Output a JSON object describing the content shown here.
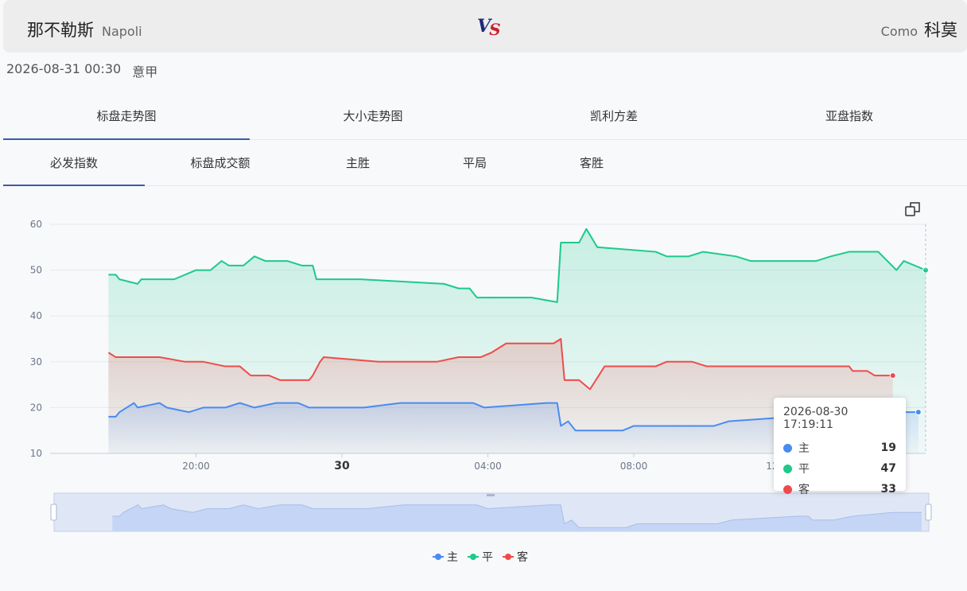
{
  "header": {
    "home_cn": "那不勒斯",
    "home_en": "Napoli",
    "away_en": "Como",
    "away_cn": "科莫",
    "vs_v": "V",
    "vs_s": "S"
  },
  "match_info": {
    "datetime": "2026-08-31 00:30",
    "league": "意甲"
  },
  "tabs": [
    {
      "label": "标盘走势图",
      "active": true
    },
    {
      "label": "大小走势图",
      "active": false
    },
    {
      "label": "凯利方差",
      "active": false
    },
    {
      "label": "亚盘指数",
      "active": false
    }
  ],
  "subtabs": [
    {
      "label": "必发指数",
      "active": true
    },
    {
      "label": "标盘成交额",
      "active": false
    },
    {
      "label": "主胜",
      "active": false
    },
    {
      "label": "平局",
      "active": false
    },
    {
      "label": "客胜",
      "active": false
    }
  ],
  "tooltip": {
    "time": "2026-08-30 17:19:11",
    "rows": [
      {
        "name": "主",
        "value": "19"
      },
      {
        "name": "平",
        "value": "47"
      },
      {
        "name": "客",
        "value": "33"
      }
    ]
  },
  "legend": [
    "主",
    "平",
    "客"
  ],
  "colors": {
    "home": "#4a8bf0",
    "draw": "#1ec98a",
    "away": "#ef4b4b",
    "accent": "#3d5aa9"
  },
  "chart_data": {
    "type": "area",
    "x_unit": "hours",
    "x_range": [
      17.0,
      29.0
    ],
    "x_ticks": [
      {
        "x": 19.0,
        "label": "20:00",
        "bold": false
      },
      {
        "x": 21.0,
        "label": "30",
        "bold": true
      },
      {
        "x": 23.0,
        "label": "04:00",
        "bold": false
      },
      {
        "x": 25.0,
        "label": "08:00",
        "bold": false
      },
      {
        "x": 27.0,
        "label": "12:00",
        "bold": false
      }
    ],
    "y_range": [
      10,
      60
    ],
    "y_ticks": [
      10,
      20,
      30,
      40,
      50,
      60
    ],
    "series": [
      {
        "name": "主",
        "color": "#4a8bf0",
        "points": [
          [
            17.8,
            18
          ],
          [
            17.9,
            18
          ],
          [
            17.95,
            19
          ],
          [
            18.15,
            21
          ],
          [
            18.2,
            20
          ],
          [
            18.5,
            21
          ],
          [
            18.6,
            20
          ],
          [
            18.9,
            19
          ],
          [
            19.1,
            20
          ],
          [
            19.4,
            20
          ],
          [
            19.6,
            21
          ],
          [
            19.8,
            20
          ],
          [
            19.95,
            20.5
          ],
          [
            20.1,
            21
          ],
          [
            20.4,
            21
          ],
          [
            20.55,
            20
          ],
          [
            21.3,
            20
          ],
          [
            21.8,
            21
          ],
          [
            22.8,
            21
          ],
          [
            22.95,
            20
          ],
          [
            23.8,
            21
          ],
          [
            23.95,
            21
          ],
          [
            24.0,
            16
          ],
          [
            24.1,
            17
          ],
          [
            24.2,
            15
          ],
          [
            24.85,
            15
          ],
          [
            25.0,
            16
          ],
          [
            25.2,
            16
          ],
          [
            25.6,
            16
          ],
          [
            26.1,
            16
          ],
          [
            26.3,
            17
          ],
          [
            27.2,
            18
          ],
          [
            27.35,
            18
          ],
          [
            27.4,
            17
          ],
          [
            27.7,
            17
          ],
          [
            27.95,
            18
          ],
          [
            28.5,
            19
          ],
          [
            28.9,
            19
          ]
        ]
      },
      {
        "name": "平",
        "color": "#1ec98a",
        "points": [
          [
            17.8,
            49
          ],
          [
            17.9,
            49
          ],
          [
            17.95,
            48
          ],
          [
            18.2,
            47
          ],
          [
            18.25,
            48
          ],
          [
            18.7,
            48
          ],
          [
            19.0,
            50
          ],
          [
            19.2,
            50
          ],
          [
            19.35,
            52
          ],
          [
            19.45,
            51
          ],
          [
            19.65,
            51
          ],
          [
            19.8,
            53
          ],
          [
            19.95,
            52
          ],
          [
            20.25,
            52
          ],
          [
            20.45,
            51
          ],
          [
            20.6,
            51
          ],
          [
            20.65,
            48
          ],
          [
            21.25,
            48
          ],
          [
            22.4,
            47
          ],
          [
            22.6,
            46
          ],
          [
            22.75,
            46
          ],
          [
            22.85,
            44
          ],
          [
            23.6,
            44
          ],
          [
            23.95,
            43
          ],
          [
            24.0,
            56
          ],
          [
            24.25,
            56
          ],
          [
            24.35,
            59
          ],
          [
            24.5,
            55
          ],
          [
            25.3,
            54
          ],
          [
            25.45,
            53
          ],
          [
            25.75,
            53
          ],
          [
            25.95,
            54
          ],
          [
            26.4,
            53
          ],
          [
            26.6,
            52
          ],
          [
            26.9,
            52
          ],
          [
            27.5,
            52
          ],
          [
            27.7,
            53
          ],
          [
            27.95,
            54
          ],
          [
            28.35,
            54
          ],
          [
            28.6,
            50
          ],
          [
            28.7,
            52
          ],
          [
            29.0,
            50
          ]
        ]
      },
      {
        "name": "客",
        "color": "#ef4b4b",
        "points": [
          [
            17.8,
            32
          ],
          [
            17.9,
            31
          ],
          [
            18.15,
            31
          ],
          [
            18.5,
            31
          ],
          [
            18.85,
            30
          ],
          [
            19.1,
            30
          ],
          [
            19.4,
            29
          ],
          [
            19.6,
            29
          ],
          [
            19.75,
            27
          ],
          [
            20.0,
            27
          ],
          [
            20.15,
            26
          ],
          [
            20.55,
            26
          ],
          [
            20.6,
            27
          ],
          [
            20.7,
            30
          ],
          [
            20.75,
            31
          ],
          [
            21.5,
            30
          ],
          [
            22.3,
            30
          ],
          [
            22.6,
            31
          ],
          [
            22.9,
            31
          ],
          [
            23.05,
            32
          ],
          [
            23.25,
            34
          ],
          [
            23.6,
            34
          ],
          [
            23.9,
            34
          ],
          [
            24.0,
            35
          ],
          [
            24.05,
            26
          ],
          [
            24.25,
            26
          ],
          [
            24.4,
            24
          ],
          [
            24.6,
            29
          ],
          [
            25.3,
            29
          ],
          [
            25.45,
            30
          ],
          [
            25.8,
            30
          ],
          [
            26.0,
            29
          ],
          [
            26.6,
            29
          ],
          [
            27.5,
            29
          ],
          [
            27.95,
            29
          ],
          [
            28.0,
            28
          ],
          [
            28.2,
            28
          ],
          [
            28.3,
            27
          ],
          [
            28.55,
            27
          ]
        ]
      }
    ],
    "minimap": "series-overview"
  }
}
